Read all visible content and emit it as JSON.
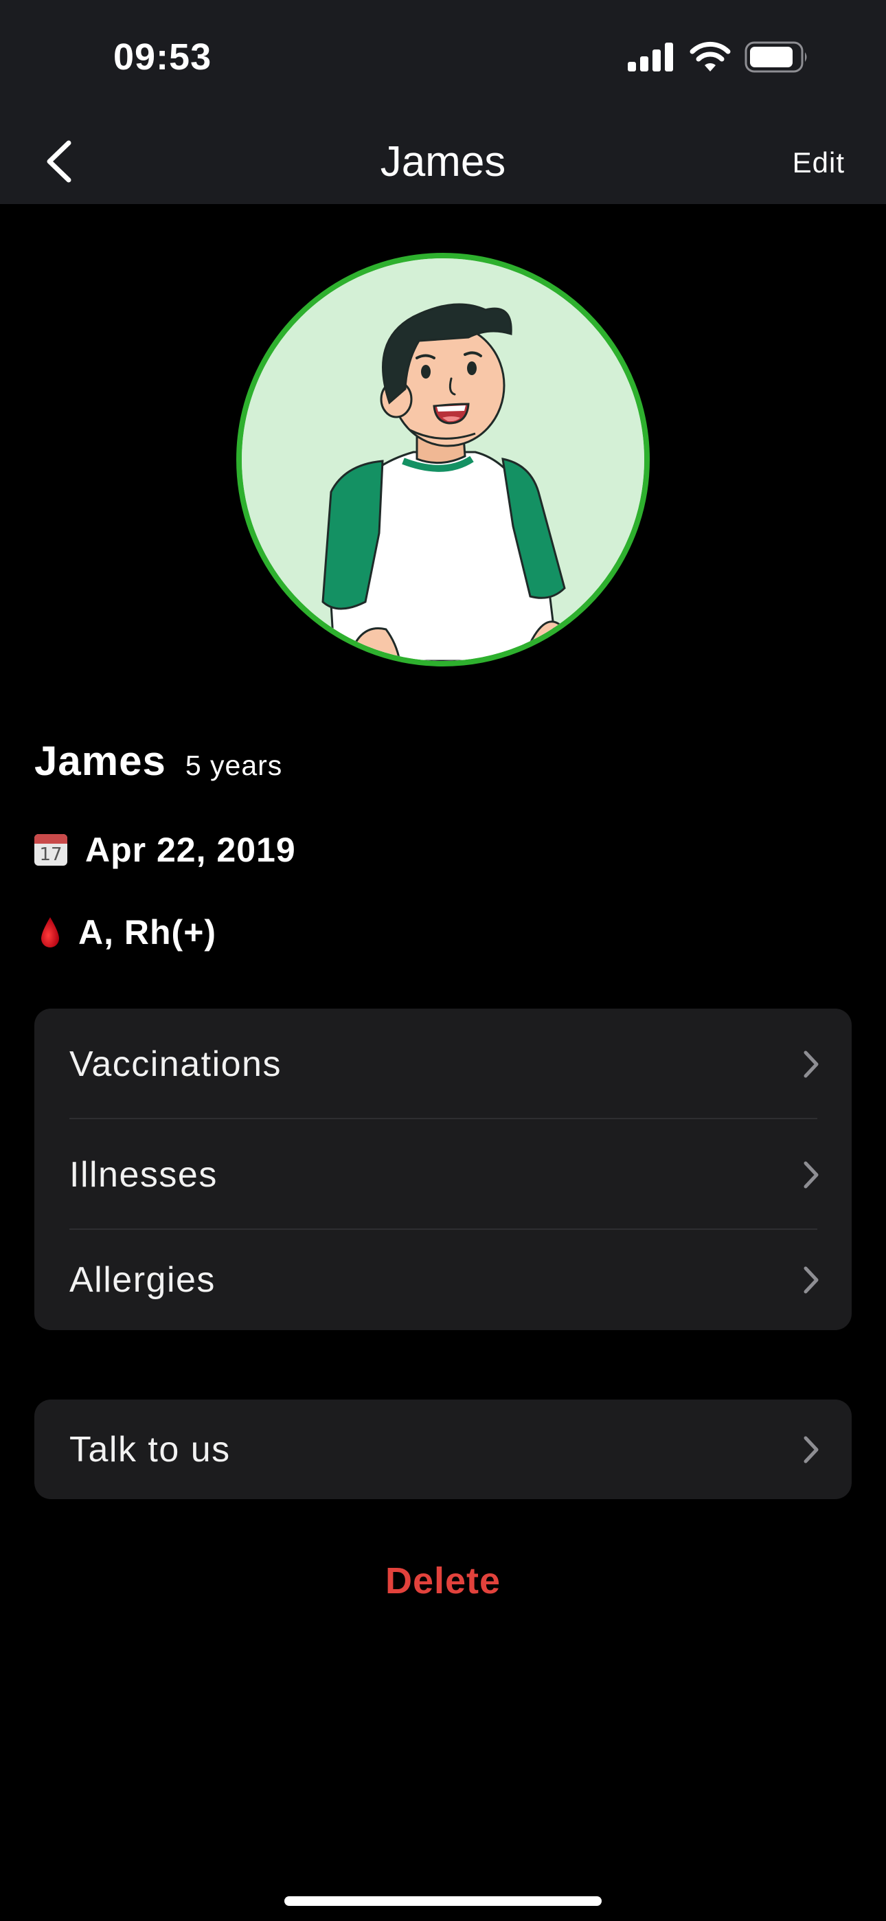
{
  "status_bar": {
    "time": "09:53",
    "icons": [
      "cellular-signal-icon",
      "wifi-icon",
      "battery-icon"
    ]
  },
  "nav": {
    "back_icon": "chevron-left-icon",
    "title": "James",
    "edit_label": "Edit"
  },
  "profile": {
    "avatar_border_color": "#2eb02e",
    "name": "James",
    "age": "5 years",
    "dob_icon": "calendar-icon",
    "calendar_day": "17",
    "date_of_birth": "Apr 22, 2019",
    "blood_icon": "blood-drop-icon",
    "blood_type": "A, Rh(+)"
  },
  "menu": {
    "items": [
      {
        "label": "Vaccinations"
      },
      {
        "label": "Illnesses"
      },
      {
        "label": "Allergies"
      }
    ],
    "support": {
      "label": "Talk to us"
    }
  },
  "delete_label": "Delete",
  "colors": {
    "background": "#000000",
    "header": "#1b1c20",
    "card": "#1c1c1e",
    "destructive": "#e2423c",
    "accent_green": "#2eb02e"
  }
}
